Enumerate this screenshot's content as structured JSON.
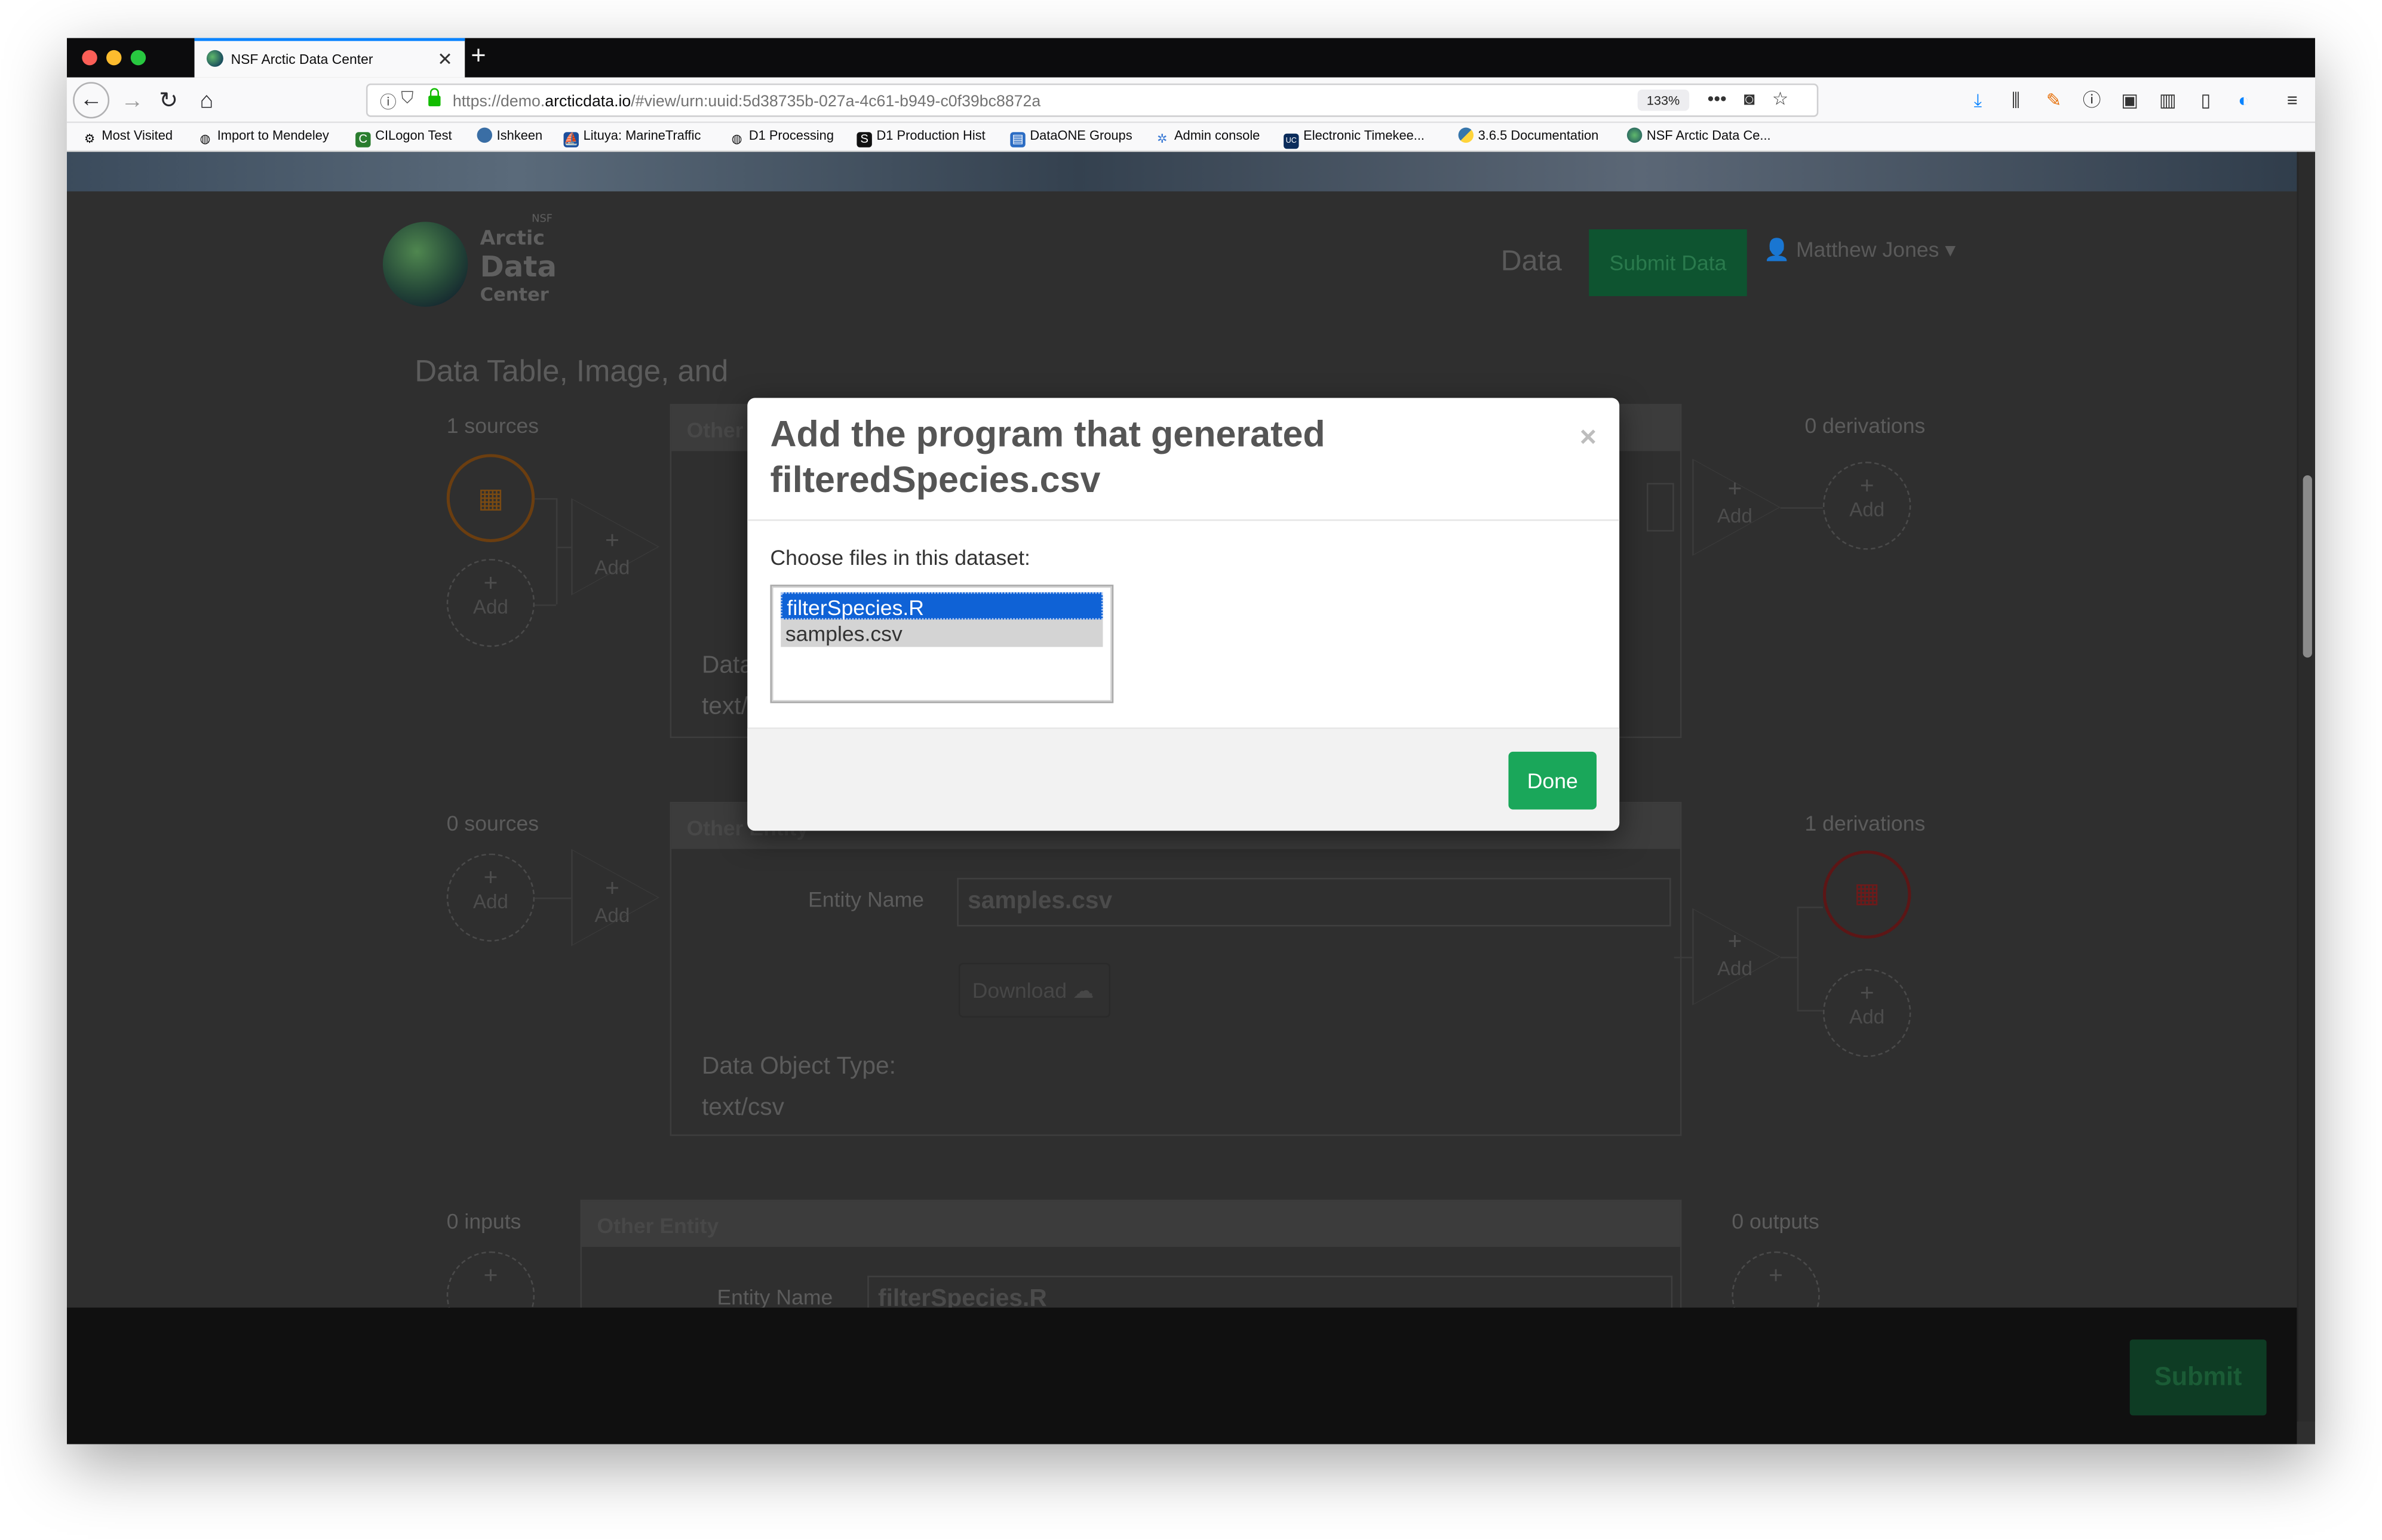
{
  "browser": {
    "tab_title": "NSF Arctic Data Center",
    "url_prefix": "https://demo.",
    "url_domain": "arcticdata.io",
    "url_path": "/#view/urn:uuid:5d38735b-027a-4c61-b949-c0f39bc8872a",
    "zoom": "133%",
    "more": "•••"
  },
  "bookmarks": [
    {
      "label": "Most Visited"
    },
    {
      "label": "Import to Mendeley"
    },
    {
      "label": "CILogon Test"
    },
    {
      "label": "Ishkeen"
    },
    {
      "label": "Lituya: MarineTraffic"
    },
    {
      "label": "D1 Processing"
    },
    {
      "label": "D1 Production Hist"
    },
    {
      "label": "DataONE Groups"
    },
    {
      "label": "Admin console"
    },
    {
      "label": "Electronic Timekee..."
    },
    {
      "label": "3.6.5 Documentation"
    },
    {
      "label": "NSF Arctic Data Ce..."
    }
  ],
  "site": {
    "logo_nsf": "NSF",
    "logo_arctic": "Arctic",
    "logo_data": "Data",
    "logo_center": "Center",
    "nav_data": "Data",
    "submit_data": "Submit Data",
    "user_name": "Matthew Jones",
    "heading": "Data Table, Image, and"
  },
  "sections": {
    "s1": {
      "sources": "1 sources",
      "derivations": "0 derivations",
      "panel_title": "Other",
      "data_type_label": "Data",
      "data_type_value": "text/"
    },
    "s2": {
      "sources": "0 sources",
      "derivations": "1 derivations",
      "panel_title": "Other Entity",
      "entity_name_label": "Entity Name",
      "entity_name_value": "samples.csv",
      "download_label": "Download",
      "data_type_label": "Data Object Type:",
      "data_type_value": "text/csv"
    },
    "s3": {
      "inputs": "0 inputs",
      "outputs": "0 outputs",
      "panel_title": "Other Entity",
      "entity_name_label": "Entity Name",
      "entity_name_value": "filterSpecies.R"
    },
    "add_label": "Add"
  },
  "footer": {
    "submit_label": "Submit"
  },
  "modal": {
    "title_line1": "Add the program that generated",
    "title_line2": "filteredSpecies.csv",
    "close": "×",
    "prompt": "Choose files in this dataset:",
    "options": [
      {
        "label": "filterSpecies.R",
        "state": "selected"
      },
      {
        "label": "samples.csv",
        "state": "unselected"
      }
    ],
    "done_label": "Done"
  }
}
